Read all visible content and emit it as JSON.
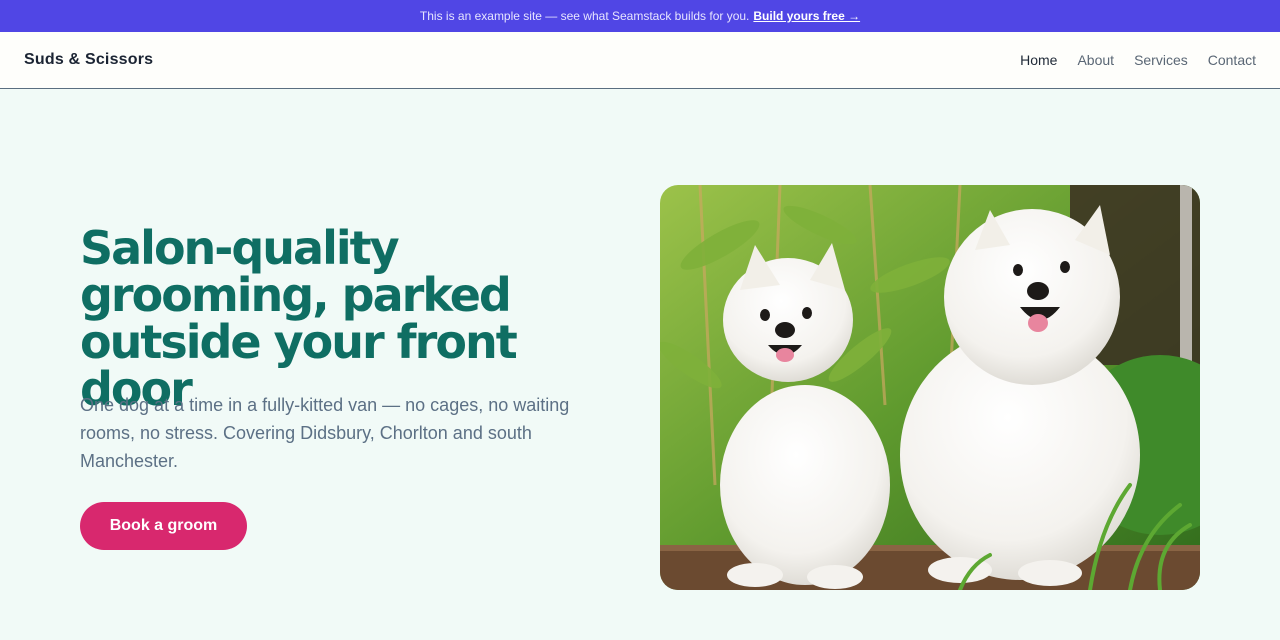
{
  "banner": {
    "text": "This is an example site — see what Seamstack builds for you.",
    "link": "Build yours free →"
  },
  "nav": {
    "brand": "Suds & Scissors",
    "links": [
      "Home",
      "About",
      "Services",
      "Contact"
    ]
  },
  "hero": {
    "headline": "Salon-quality grooming, parked outside your front door",
    "subtext": "One dog at a time in a fully-kitted van — no cages, no waiting rooms, no stress. Covering Didsbury, Chorlton and south Manchester.",
    "cta": "Book a groom",
    "image": "photo-two-white-samoyed-dogs"
  },
  "colors": {
    "banner": "#5046e5",
    "headline": "#0f6e63",
    "cta": "#d8286e",
    "page_bg": "#f1faf7"
  }
}
